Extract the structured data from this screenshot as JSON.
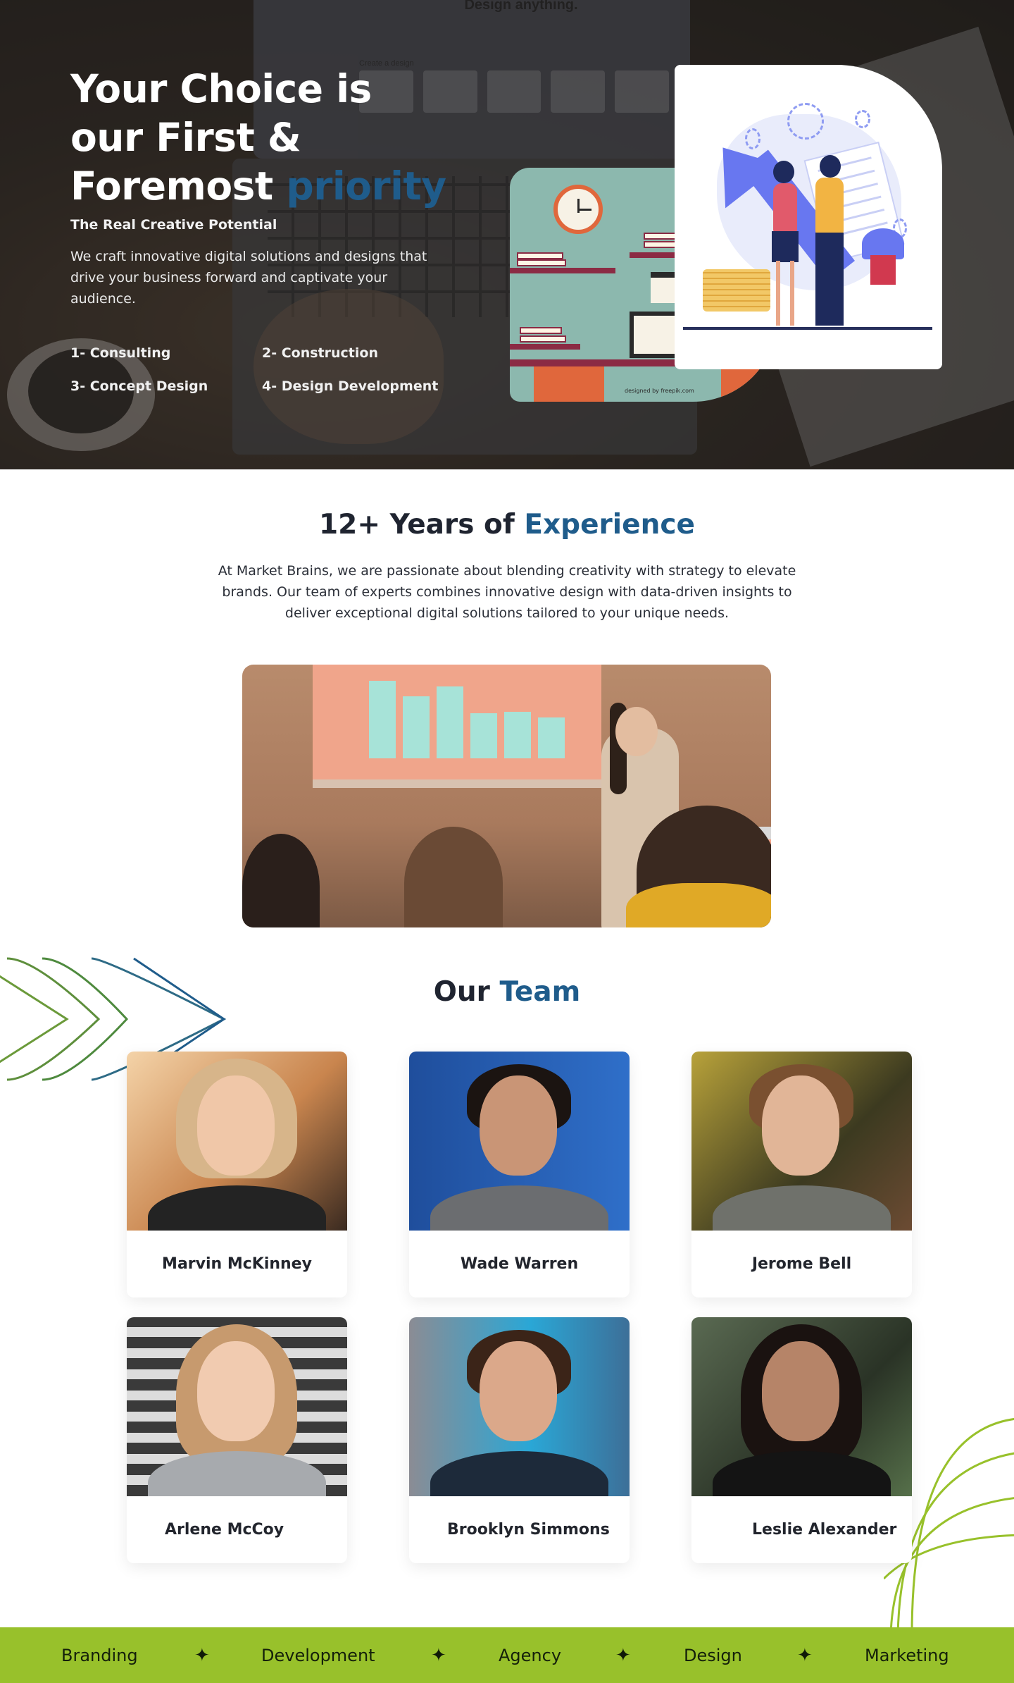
{
  "hero": {
    "title_line1": "Your Choice is",
    "title_line2": "our First &",
    "title_line3_prefix": "Foremost ",
    "title_accent": "priority",
    "tagline": "The Real Creative Potential",
    "description": "We craft innovative digital solutions and designs that drive your business forward and captivate your audience.",
    "services": [
      "1- Consulting",
      "2- Construction",
      "3- Concept Design",
      "4- Design Development"
    ],
    "illustration_credit": "designed by freepik.com",
    "laptop_screen_title": "Design anything.",
    "laptop_screen_sub": "Create a design",
    "accent_color": "#1f5c8b"
  },
  "experience": {
    "title_prefix": "12+ Years of ",
    "title_accent": "Experience",
    "description": "At Market Brains, we are passionate about blending creativity with strategy to elevate brands. Our team of experts combines innovative design with data-driven insights to deliver exceptional digital solutions tailored to your unique needs."
  },
  "team": {
    "title_prefix": "Our ",
    "title_accent": "Team",
    "members": [
      {
        "name": "Marvin McKinney"
      },
      {
        "name": "Wade Warren"
      },
      {
        "name": "Jerome Bell"
      },
      {
        "name": "Arlene McCoy"
      },
      {
        "name": "Brooklyn Simmons"
      },
      {
        "name": "Leslie Alexander"
      }
    ]
  },
  "marquee": {
    "items": [
      "Branding",
      "Development",
      "Agency",
      "Design",
      "Marketing"
    ],
    "separator_icon": "four-point-star-icon",
    "background_color": "#98c12b"
  }
}
